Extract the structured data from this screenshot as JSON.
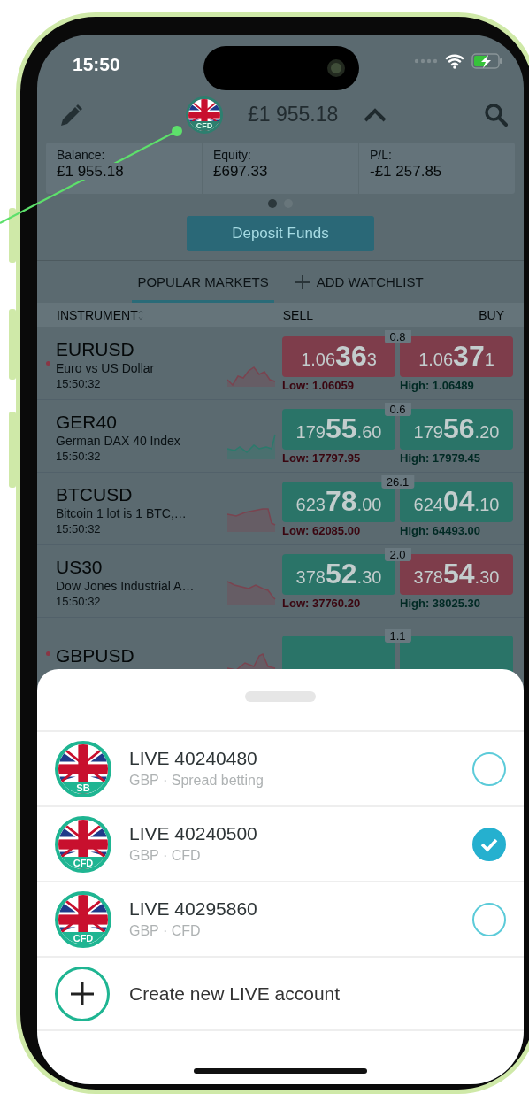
{
  "status_bar": {
    "time": "15:50"
  },
  "header": {
    "account_badge": "CFD",
    "balance": "£1 955.18"
  },
  "summary": [
    {
      "label": "Balance:",
      "value": "£1 955.18"
    },
    {
      "label": "Equity:",
      "value": "£697.33"
    },
    {
      "label": "P/L:",
      "value": "-£1 257.85"
    }
  ],
  "pager": [
    {
      "selected": true
    },
    {
      "selected": false
    }
  ],
  "deposit_button": "Deposit Funds",
  "tabs": [
    {
      "label": "POPULAR MARKETS",
      "selected": true,
      "kind": "tab"
    },
    {
      "label": "ADD WATCHLIST",
      "selected": false,
      "kind": "add"
    }
  ],
  "columns": [
    "INSTRUMENT",
    "SELL",
    "BUY"
  ],
  "markets": [
    {
      "symbol": "EURUSD",
      "name": "Euro vs US Dollar",
      "time": "15:50:32",
      "alert": true,
      "rising": false,
      "spread": "0.8",
      "sell": {
        "pre": "1.06",
        "big": "36",
        "post": "3",
        "rising": false
      },
      "buy": {
        "pre": "1.06",
        "big": "37",
        "post": "1",
        "rising": false
      },
      "low": "Low: 1.06059",
      "high": "High: 1.06489"
    },
    {
      "symbol": "GER40",
      "name": "German DAX 40 Index",
      "time": "15:50:32",
      "alert": false,
      "rising": true,
      "spread": "0.6",
      "sell": {
        "pre": "179",
        "big": "55",
        "post": ".60",
        "rising": true
      },
      "buy": {
        "pre": "179",
        "big": "56",
        "post": ".20",
        "rising": true
      },
      "low": "Low: 17797.95",
      "high": "High: 17979.45"
    },
    {
      "symbol": "BTCUSD",
      "name": "Bitcoin 1 lot  is 1 BTC,…",
      "time": "15:50:32",
      "alert": false,
      "rising": false,
      "spread": "26.1",
      "sell": {
        "pre": "623",
        "big": "78",
        "post": ".00",
        "rising": true
      },
      "buy": {
        "pre": "624",
        "big": "04",
        "post": ".10",
        "rising": true
      },
      "low": "Low: 62085.00",
      "high": "High: 64493.00"
    },
    {
      "symbol": "US30",
      "name": "Dow Jones Industrial A…",
      "time": "15:50:32",
      "alert": false,
      "rising": false,
      "spread": "2.0",
      "sell": {
        "pre": "378",
        "big": "52",
        "post": ".30",
        "rising": true
      },
      "buy": {
        "pre": "378",
        "big": "54",
        "post": ".30",
        "rising": false
      },
      "low": "Low: 37760.20",
      "high": "High: 38025.30"
    },
    {
      "symbol": "GBPUSD",
      "alert": true,
      "rising": false,
      "spread": "1.1",
      "sell": {
        "rising": true
      },
      "buy": {
        "rising": true
      }
    }
  ],
  "accounts": [
    {
      "title": "LIVE 40240480",
      "subtitle": "GBP · Spread betting",
      "badge": "SB",
      "selected": false
    },
    {
      "title": "LIVE 40240500",
      "subtitle": "GBP · CFD",
      "badge": "CFD",
      "selected": true
    },
    {
      "title": "LIVE 40295860",
      "subtitle": "GBP · CFD",
      "badge": "CFD",
      "selected": false
    }
  ],
  "create_account": "Create new LIVE account"
}
